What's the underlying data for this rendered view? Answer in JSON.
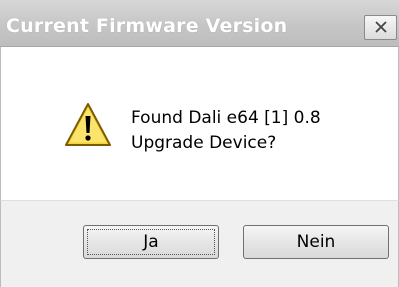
{
  "window": {
    "title": "Current Firmware Version",
    "close_icon": "close-icon"
  },
  "message": {
    "icon": "warning-icon",
    "line1": "Found Dali e64 [1] 0.8",
    "line2": "Upgrade Device?"
  },
  "buttons": {
    "yes_label": "Ja",
    "no_label": "Nein"
  },
  "colors": {
    "title_text": "#ffffff",
    "warning_fill": "#f6d33b",
    "warning_border": "#7a5b00"
  }
}
